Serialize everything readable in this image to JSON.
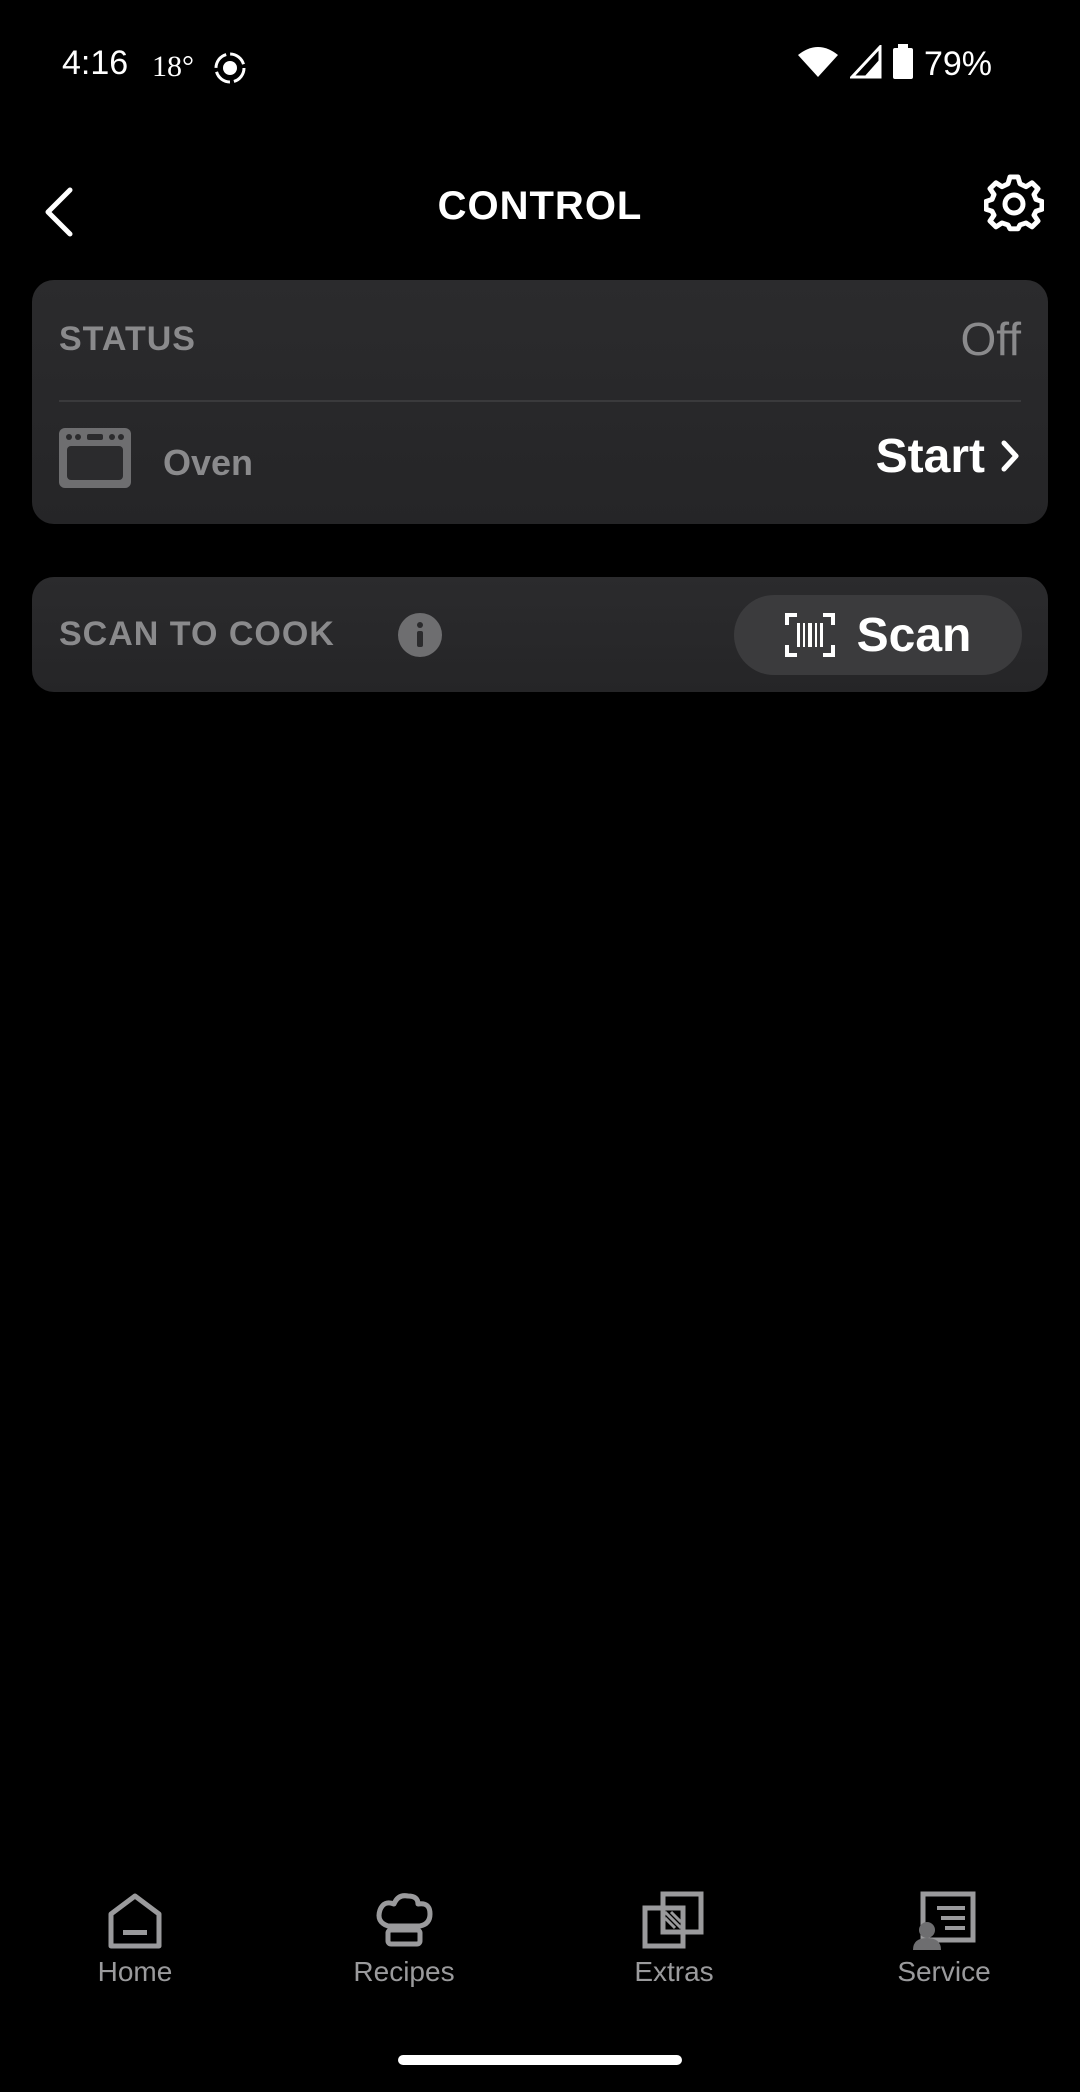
{
  "status_bar": {
    "time": "4:16",
    "temperature": "18°",
    "battery": "79%"
  },
  "header": {
    "title": "CONTROL",
    "back_icon": "chevron-left-icon",
    "settings_icon": "gear-icon"
  },
  "status_card": {
    "label": "STATUS",
    "value": "Off",
    "appliance_label": "Oven",
    "action_label": "Start"
  },
  "scan_card": {
    "label": "SCAN TO COOK",
    "button_label": "Scan"
  },
  "bottom_nav": {
    "items": [
      {
        "label": "Home",
        "icon": "home-icon"
      },
      {
        "label": "Recipes",
        "icon": "chef-hat-icon"
      },
      {
        "label": "Extras",
        "icon": "extras-icon"
      },
      {
        "label": "Service",
        "icon": "service-icon"
      }
    ]
  },
  "colors": {
    "background": "#000000",
    "card": "#2b2b2d",
    "muted_text": "#8a8a8c",
    "button": "#3b3b3d"
  }
}
